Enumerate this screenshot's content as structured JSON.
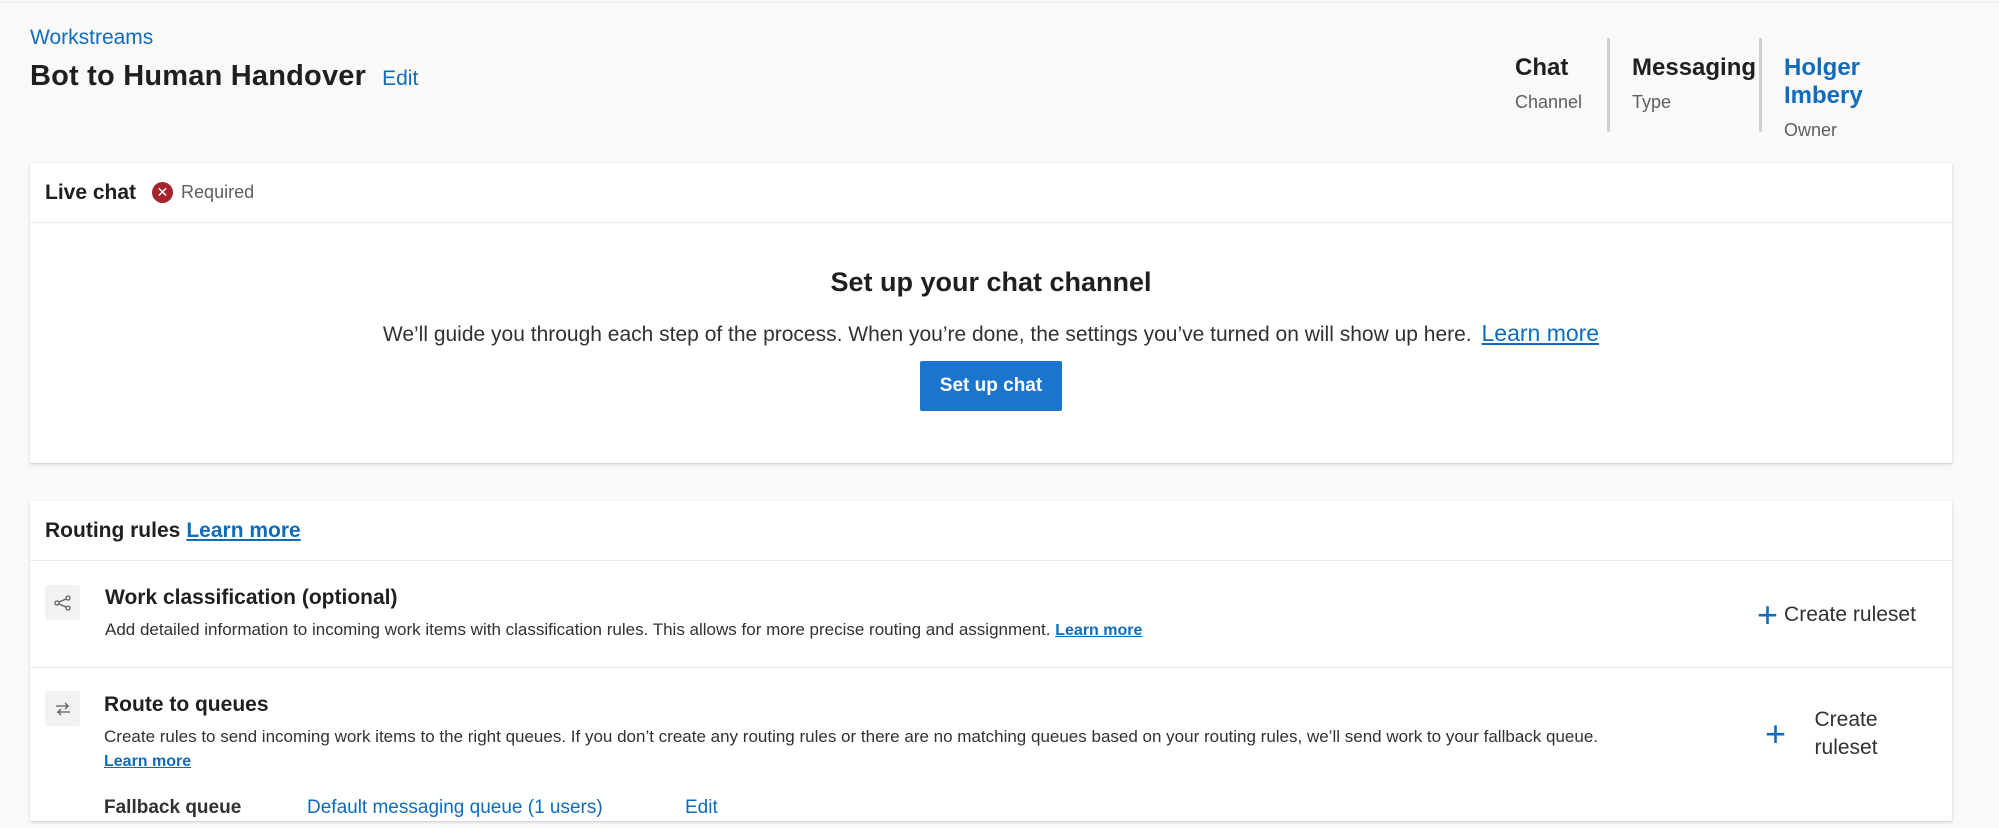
{
  "header": {
    "breadcrumb": "Workstreams",
    "title": "Bot to Human Handover",
    "edit_label": "Edit",
    "meta": [
      {
        "value": "Chat",
        "label": "Channel"
      },
      {
        "value": "Messaging",
        "label": "Type"
      },
      {
        "value": "Holger Imbery",
        "label": "Owner"
      }
    ]
  },
  "live_chat": {
    "title": "Live chat",
    "status_icon": "error-x-icon",
    "status_text": "Required",
    "setup_title": "Set up your chat channel",
    "setup_desc": "We’ll guide you through each step of the process. When you’re done, the settings you’ve turned on will show up here.",
    "learn_more": "Learn more",
    "setup_button": "Set up chat"
  },
  "routing": {
    "title": "Routing rules",
    "learn_more": "Learn more",
    "work_classification": {
      "icon": "share-nodes-icon",
      "title": "Work classification (optional)",
      "desc": "Add detailed information to incoming work items with classification rules. This allows for more precise routing and assignment.",
      "learn_more": "Learn more",
      "create_label": "Create ruleset"
    },
    "route_to_queues": {
      "icon": "route-arrows-icon",
      "title": "Route to queues",
      "desc": "Create rules to send incoming work items to the right queues. If you don’t create any routing rules or there are no matching queues based on your routing rules, we’ll send work to your fallback queue.",
      "learn_more": "Learn more",
      "create_label": "Create ruleset"
    },
    "fallback": {
      "label": "Fallback queue",
      "value": "Default messaging queue (1 users)",
      "edit_label": "Edit"
    }
  }
}
